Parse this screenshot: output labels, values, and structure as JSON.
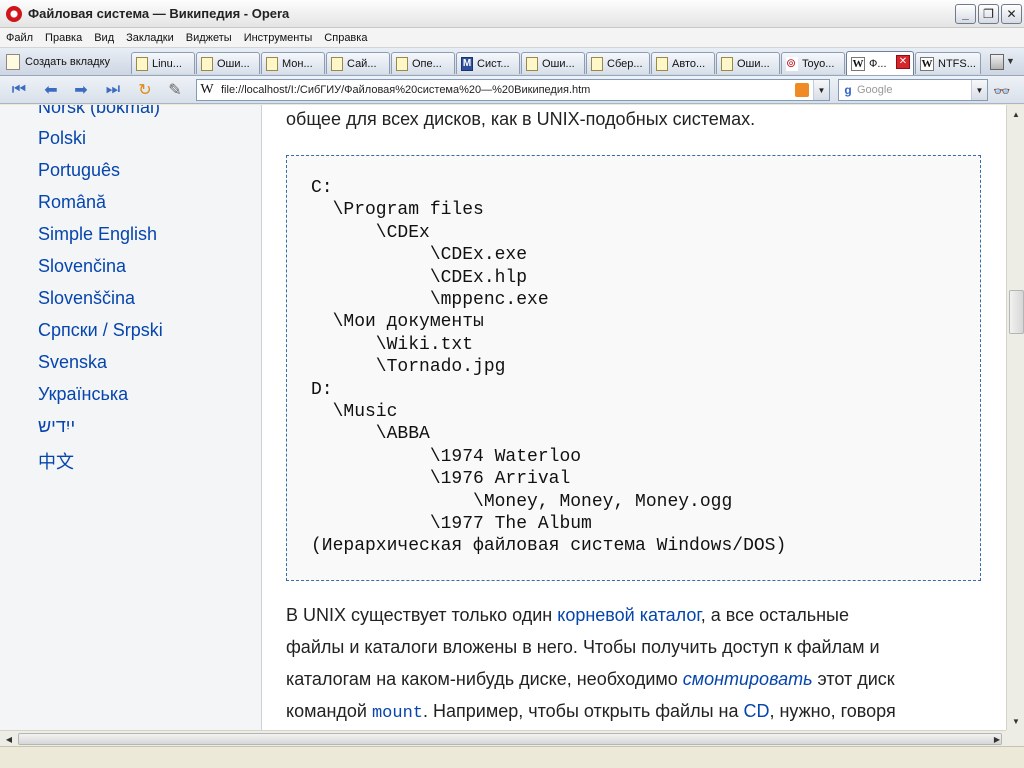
{
  "window": {
    "title": "Файловая система — Википедия - Opera"
  },
  "menu": [
    "Файл",
    "Правка",
    "Вид",
    "Закладки",
    "Виджеты",
    "Инструменты",
    "Справка"
  ],
  "tabs": {
    "new_tab_label": "Создать вкладку",
    "items": [
      {
        "label": "Linu...",
        "icon": "page-icon"
      },
      {
        "label": "Оши...",
        "icon": "page-icon"
      },
      {
        "label": "Мон...",
        "icon": "page-icon"
      },
      {
        "label": "Сай...",
        "icon": "page-icon"
      },
      {
        "label": "Опе...",
        "icon": "page-icon"
      },
      {
        "label": "Сист...",
        "icon": "m-icon"
      },
      {
        "label": "Оши...",
        "icon": "page-icon"
      },
      {
        "label": "Сбер...",
        "icon": "page-icon"
      },
      {
        "label": "Авто...",
        "icon": "page-icon"
      },
      {
        "label": "Оши...",
        "icon": "page-icon"
      },
      {
        "label": "Toyo...",
        "icon": "toyota-icon"
      },
      {
        "label": "Ф...",
        "icon": "wikipedia-icon",
        "active": true
      },
      {
        "label": "NTFS...",
        "icon": "wikipedia-icon"
      }
    ]
  },
  "address": {
    "url": "file://localhost/I:/СибГИУ/Файловая%20система%20—%20Википедия.htm",
    "search_placeholder": "Google"
  },
  "sidebar": {
    "languages": [
      "Norsk (bokmål)",
      "Polski",
      "Português",
      "Română",
      "Simple English",
      "Slovenčina",
      "Slovenščina",
      "Српски / Srpski",
      "Svenska",
      "Українська",
      "ייִדיש",
      "中文"
    ]
  },
  "article": {
    "intro_line": "общее для всех дисков, как в UNIX-подобных системах.",
    "pre_lines": [
      "C:",
      "  \\Program files",
      "      \\CDEx",
      "           \\CDEx.exe",
      "           \\CDEx.hlp",
      "           \\mppenc.exe",
      "  \\Мои документы",
      "      \\Wiki.txt",
      "      \\Tornado.jpg",
      "D:",
      "  \\Music",
      "      \\ABBA",
      "           \\1974 Waterloo",
      "           \\1976 Arrival",
      "               \\Money, Money, Money.ogg",
      "           \\1977 The Album",
      "(Иерархическая файловая система Windows/DOS)"
    ],
    "p1": {
      "part1": "В UNIX существует только один ",
      "link1": "корневой каталог",
      "part2": ", а все остальные"
    },
    "p2": "файлы и каталоги вложены в него. Чтобы получить доступ к файлам и",
    "p3": {
      "part1": "каталогам на каком-нибудь диске, необходимо ",
      "link1": "смонтировать",
      "part2": " этот диск"
    },
    "p4": {
      "part1": "командой ",
      "code": "mount",
      "part2": ". Например, чтобы открыть файлы на ",
      "link1": "CD",
      "part3": ", нужно, говоря"
    }
  }
}
